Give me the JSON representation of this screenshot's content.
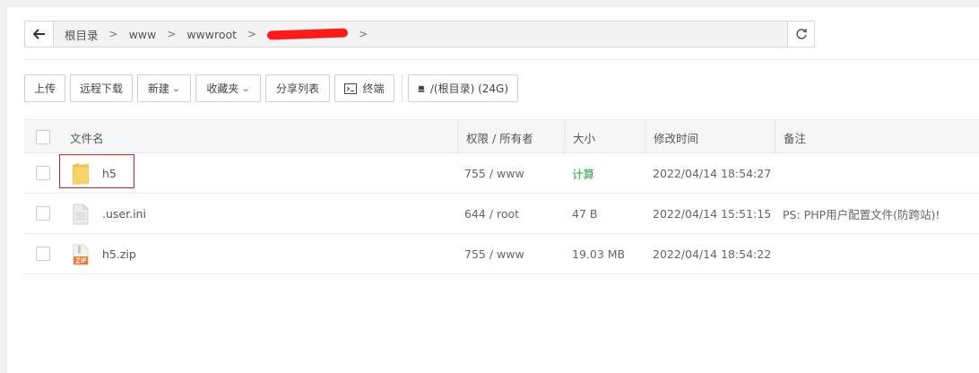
{
  "path": {
    "crumbs": [
      "根目录",
      "www",
      "wwwroot"
    ]
  },
  "toolbar": {
    "upload": "上传",
    "remote_download": "远程下载",
    "new": "新建",
    "favorites": "收藏夹",
    "share_list": "分享列表",
    "terminal": "终端",
    "disk": "/(根目录) (24G)"
  },
  "table": {
    "headers": {
      "name": "文件名",
      "perm": "权限 / 所有者",
      "size": "大小",
      "mtime": "修改时间",
      "note": "备注"
    },
    "rows": [
      {
        "name": "h5",
        "perm": "755 / www",
        "size": "计算",
        "mtime": "2022/04/14 18:54:27",
        "note": "",
        "icon": "folder-icon"
      },
      {
        "name": ".user.ini",
        "perm": "644 / root",
        "size": "47 B",
        "mtime": "2022/04/14 15:51:15",
        "note": "PS: PHP用户配置文件(防跨站)!",
        "icon": "file-icon"
      },
      {
        "name": "h5.zip",
        "perm": "755 / www",
        "size": "19.03 MB",
        "mtime": "2022/04/14 18:54:22",
        "note": "",
        "icon": "zip-icon"
      }
    ]
  },
  "colors": {
    "accent_green": "#20a53a",
    "highlight_red": "#e02020",
    "folder_yellow": "#f5c84c",
    "zip_orange": "#f07a3a"
  }
}
